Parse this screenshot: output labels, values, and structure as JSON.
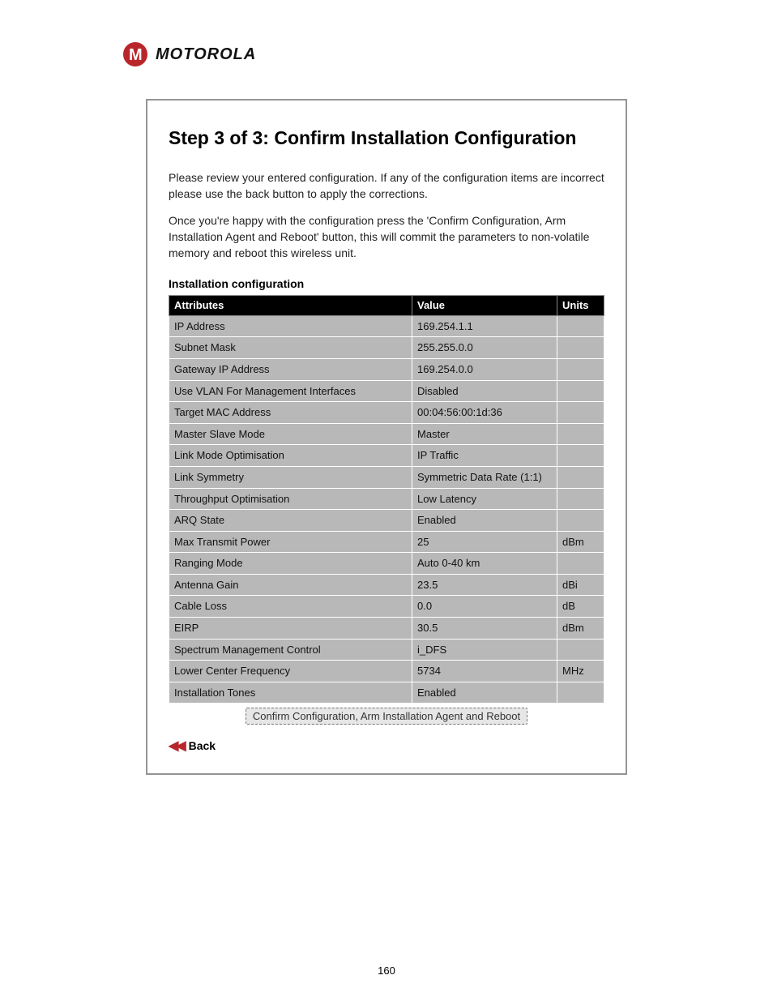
{
  "brand": {
    "name": "MOTOROLA"
  },
  "page_number": "160",
  "frame": {
    "heading": "Step 3 of 3: Confirm Installation Configuration",
    "p1": "Please review your entered configuration. If any of the configuration items are incorrect please use the back button to apply the corrections.",
    "p2": "Once you're happy with the configuration press the 'Confirm Configuration, Arm Installation Agent and Reboot' button, this will commit the parameters to non-volatile memory and reboot this wireless unit.",
    "section_heading": "Installation configuration",
    "table": {
      "headers": {
        "attr": "Attributes",
        "value": "Value",
        "units": "Units"
      },
      "rows": [
        {
          "attr": "IP Address",
          "value": "169.254.1.1",
          "units": ""
        },
        {
          "attr": "Subnet Mask",
          "value": "255.255.0.0",
          "units": ""
        },
        {
          "attr": "Gateway IP Address",
          "value": "169.254.0.0",
          "units": ""
        },
        {
          "attr": "Use VLAN For Management Interfaces",
          "value": "Disabled",
          "units": ""
        },
        {
          "attr": "Target MAC Address",
          "value": "00:04:56:00:1d:36",
          "units": ""
        },
        {
          "attr": "Master Slave Mode",
          "value": "Master",
          "units": ""
        },
        {
          "attr": "Link Mode Optimisation",
          "value": "IP Traffic",
          "units": ""
        },
        {
          "attr": "Link Symmetry",
          "value": "Symmetric Data Rate (1:1)",
          "units": ""
        },
        {
          "attr": "Throughput Optimisation",
          "value": "Low Latency",
          "units": ""
        },
        {
          "attr": "ARQ State",
          "value": "Enabled",
          "units": ""
        },
        {
          "attr": "Max Transmit Power",
          "value": "25",
          "units": "dBm"
        },
        {
          "attr": "Ranging Mode",
          "value": "Auto 0-40 km",
          "units": ""
        },
        {
          "attr": "Antenna Gain",
          "value": "23.5",
          "units": "dBi"
        },
        {
          "attr": "Cable Loss",
          "value": "0.0",
          "units": "dB"
        },
        {
          "attr": "EIRP",
          "value": "30.5",
          "units": "dBm"
        },
        {
          "attr": "Spectrum Management Control",
          "value": "i_DFS",
          "units": ""
        },
        {
          "attr": "Lower Center Frequency",
          "value": "5734",
          "units": "MHz"
        },
        {
          "attr": "Installation Tones",
          "value": "Enabled",
          "units": ""
        }
      ]
    },
    "confirm_button_label": "Confirm Configuration, Arm Installation Agent and Reboot",
    "back_label": "Back"
  }
}
